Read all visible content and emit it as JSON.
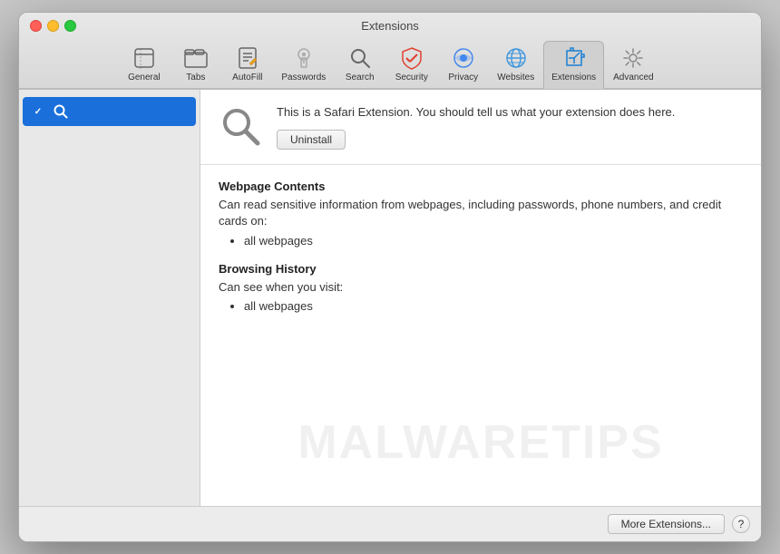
{
  "window": {
    "title": "Extensions"
  },
  "toolbar": {
    "items": [
      {
        "id": "general",
        "label": "General",
        "icon": "general"
      },
      {
        "id": "tabs",
        "label": "Tabs",
        "icon": "tabs"
      },
      {
        "id": "autofill",
        "label": "AutoFill",
        "icon": "autofill"
      },
      {
        "id": "passwords",
        "label": "Passwords",
        "icon": "passwords"
      },
      {
        "id": "search",
        "label": "Search",
        "icon": "search"
      },
      {
        "id": "security",
        "label": "Security",
        "icon": "security"
      },
      {
        "id": "privacy",
        "label": "Privacy",
        "icon": "privacy"
      },
      {
        "id": "websites",
        "label": "Websites",
        "icon": "websites"
      },
      {
        "id": "extensions",
        "label": "Extensions",
        "icon": "extensions",
        "active": true
      },
      {
        "id": "advanced",
        "label": "Advanced",
        "icon": "advanced"
      }
    ]
  },
  "sidebar": {
    "items": [
      {
        "id": "search-ext",
        "label": "",
        "checked": true
      }
    ]
  },
  "extension": {
    "description": "This is a Safari Extension. You should tell us what your extension does here.",
    "uninstall_label": "Uninstall"
  },
  "permissions": {
    "webpage_contents_title": "Webpage Contents",
    "webpage_contents_desc": "Can read sensitive information from webpages, including passwords, phone numbers, and credit cards on:",
    "webpage_contents_items": [
      "all webpages"
    ],
    "browsing_history_title": "Browsing History",
    "browsing_history_desc": "Can see when you visit:",
    "browsing_history_items": [
      "all webpages"
    ]
  },
  "footer": {
    "more_extensions_label": "More Extensions...",
    "help_label": "?"
  },
  "watermark": "MALWARETIPS"
}
